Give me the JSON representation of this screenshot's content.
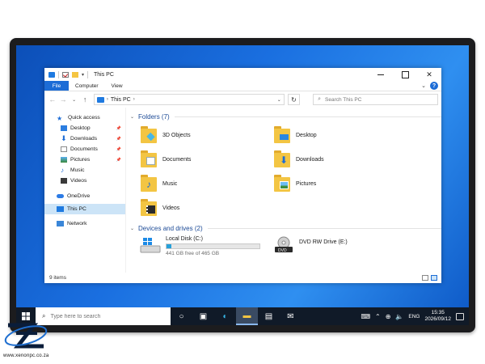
{
  "window": {
    "title": "This PC",
    "ribbon_tabs": [
      "File",
      "Computer",
      "View"
    ],
    "help": "?"
  },
  "address": {
    "path": "This PC",
    "search_placeholder": "Search This PC"
  },
  "nav": {
    "quick_access": "Quick access",
    "quick_items": [
      {
        "label": "Desktop",
        "icon": "desktop-icon"
      },
      {
        "label": "Downloads",
        "icon": "downloads-icon"
      },
      {
        "label": "Documents",
        "icon": "documents-icon"
      },
      {
        "label": "Pictures",
        "icon": "pictures-icon"
      },
      {
        "label": "Music",
        "icon": "music-icon"
      },
      {
        "label": "Videos",
        "icon": "videos-icon"
      }
    ],
    "onedrive": "OneDrive",
    "this_pc": "This PC",
    "network": "Network"
  },
  "main": {
    "folders_header": "Folders (7)",
    "folders": [
      "3D Objects",
      "Desktop",
      "Documents",
      "Downloads",
      "Music",
      "Pictures",
      "Videos"
    ],
    "drives_header": "Devices and drives (2)",
    "drives": [
      {
        "name": "Local Disk (C:)",
        "free": "441 GB free of 465 GB",
        "used_fraction": 0.05
      },
      {
        "name": "DVD RW Drive (E:)",
        "badge": "DVD"
      }
    ]
  },
  "status": {
    "items": "9 items"
  },
  "taskbar": {
    "search_placeholder": "Type here to search",
    "language": "ENG",
    "time": "15:35",
    "date": "2026/09/12"
  },
  "brand": {
    "url": "www.xenonpc.co.za"
  },
  "colors": {
    "accent": "#1c6cd6",
    "folder": "#f3c543",
    "taskbar": "#101a28",
    "desktop": "#1a6fe0"
  }
}
